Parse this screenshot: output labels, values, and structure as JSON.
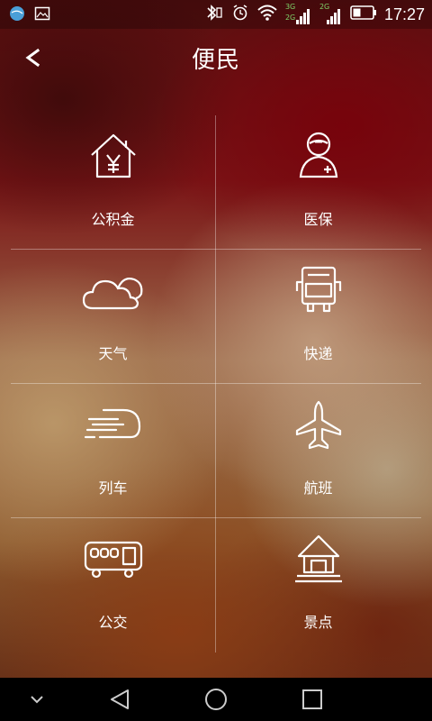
{
  "status_bar": {
    "time": "17:27",
    "network_top": "3G",
    "network_bottom": "2G",
    "network_right": "2G"
  },
  "header": {
    "title": "便民",
    "back_glyph": "<"
  },
  "services": [
    {
      "label": "公积金",
      "icon": "house-yen-icon"
    },
    {
      "label": "医保",
      "icon": "nurse-icon"
    },
    {
      "label": "天气",
      "icon": "cloud-icon"
    },
    {
      "label": "快递",
      "icon": "truck-icon"
    },
    {
      "label": "列车",
      "icon": "train-icon"
    },
    {
      "label": "航班",
      "icon": "airplane-icon"
    },
    {
      "label": "公交",
      "icon": "bus-icon"
    },
    {
      "label": "景点",
      "icon": "pavilion-icon"
    }
  ],
  "nav_bar": {
    "buttons": [
      "hide-keyboard",
      "back",
      "home",
      "recents"
    ]
  }
}
